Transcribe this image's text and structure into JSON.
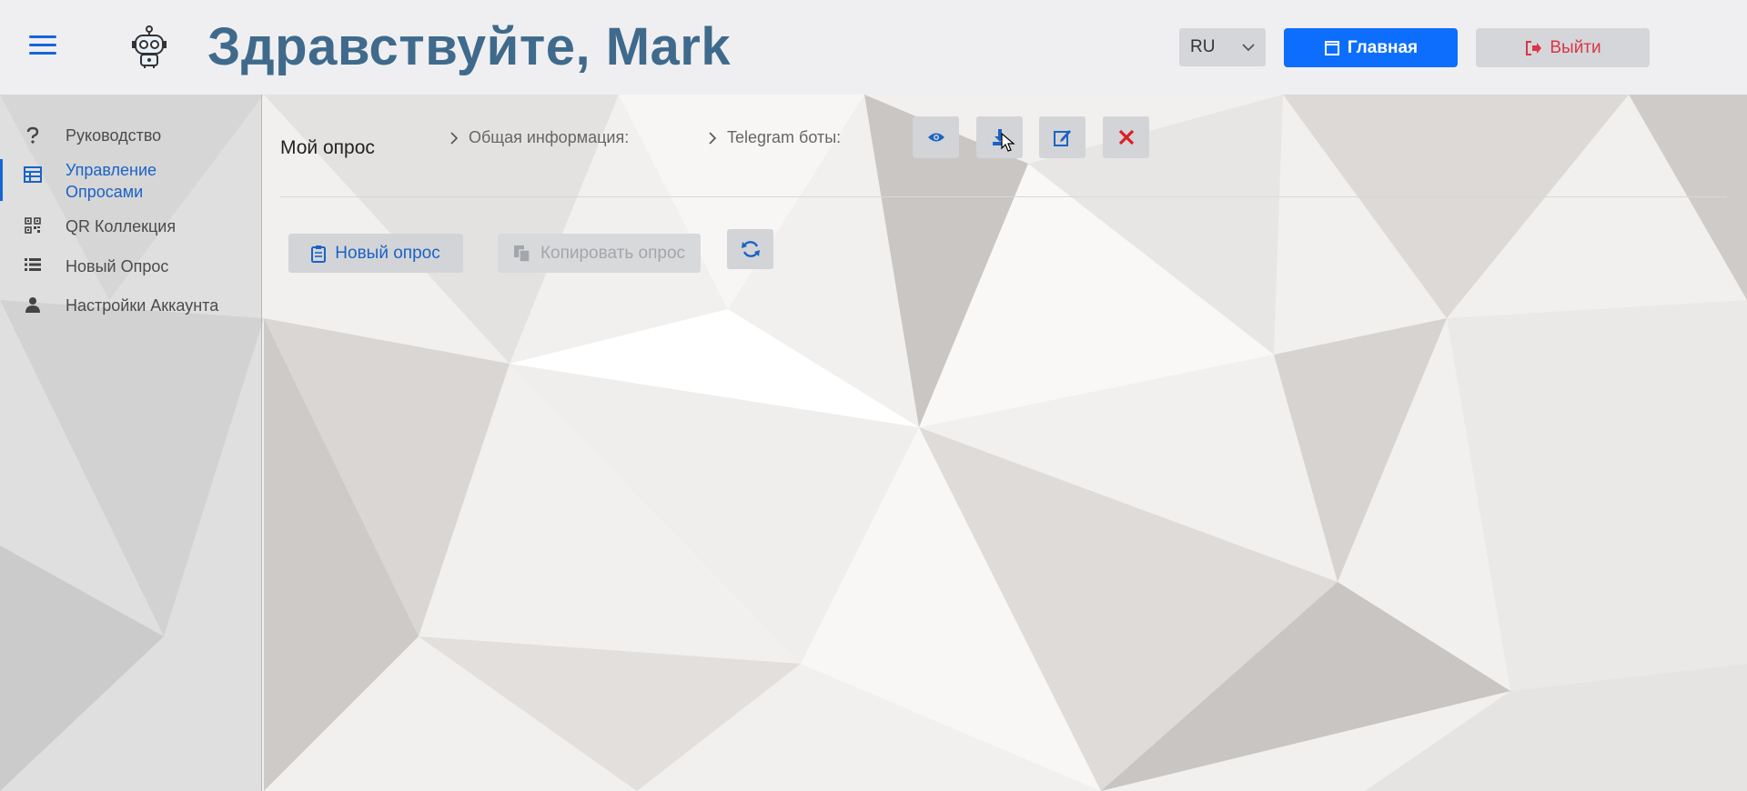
{
  "header": {
    "greeting": "Здравствуйте, Mark",
    "language": "RU",
    "home_label": "Главная",
    "logout_label": "Выйти"
  },
  "sidebar": {
    "items": [
      {
        "label": "Руководство",
        "icon": "question-icon"
      },
      {
        "label": "Управление Опросами",
        "icon": "table-icon",
        "active": true
      },
      {
        "label": "QR Коллекция",
        "icon": "qr-icon"
      },
      {
        "label": "Новый Опрос",
        "icon": "list-icon"
      },
      {
        "label": "Настройки Аккаунта",
        "icon": "user-icon"
      }
    ]
  },
  "main": {
    "breadcrumb": {
      "root": "Мой опрос",
      "general_info": "Общая информация:",
      "telegram_bots": "Telegram боты:"
    },
    "actions": [
      "eye-icon",
      "download-icon",
      "edit-icon",
      "close-icon"
    ],
    "toolbar": {
      "new_survey": "Новый опрос",
      "copy_survey": "Копировать опрос",
      "refresh_icon": "refresh-icon"
    }
  },
  "colors": {
    "accent": "#0d6efd",
    "title": "#3f6a8c",
    "danger": "#dc3545",
    "link": "#1a63c5"
  }
}
